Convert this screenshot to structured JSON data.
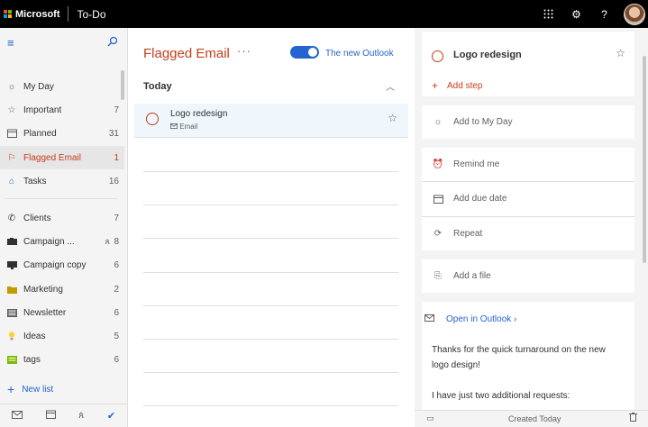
{
  "topbar": {
    "brand": "Microsoft",
    "app_name": "To-Do",
    "icons": [
      "app-launcher-icon",
      "settings-icon",
      "help-icon"
    ]
  },
  "sidebar": {
    "items": [
      {
        "label": "My Day",
        "count": "",
        "icon": "sun-icon"
      },
      {
        "label": "Important",
        "count": "7",
        "icon": "star-icon"
      },
      {
        "label": "Planned",
        "count": "31",
        "icon": "calendar-icon"
      },
      {
        "label": "Flagged Email",
        "count": "1",
        "icon": "flag-icon"
      },
      {
        "label": "Tasks",
        "count": "16",
        "icon": "home-icon"
      },
      {
        "label": "Clients",
        "count": "7",
        "icon": "phone-icon"
      },
      {
        "label": "Campaign ...",
        "count": "8",
        "icon": "camera-icon"
      },
      {
        "label": "Campaign copy",
        "count": "6",
        "icon": "monitor-icon"
      },
      {
        "label": "Marketing",
        "count": "2",
        "icon": "folder-icon"
      },
      {
        "label": "Newsletter",
        "count": "6",
        "icon": "newspaper-icon"
      },
      {
        "label": "Ideas",
        "count": "5",
        "icon": "lightbulb-icon"
      },
      {
        "label": "tags",
        "count": "6",
        "icon": "tag-list-icon"
      }
    ],
    "new_list": "New list"
  },
  "main": {
    "title": "Flagged Email",
    "toggle_label": "The new Outlook",
    "group": "Today",
    "task": {
      "title": "Logo redesign",
      "subtitle": "Email"
    }
  },
  "detail": {
    "title": "Logo redesign",
    "add_step": "Add step",
    "add_to_my_day": "Add to My Day",
    "remind_me": "Remind me",
    "add_due_date": "Add due date",
    "repeat": "Repeat",
    "add_file": "Add a file",
    "open_in_outlook": "Open in Outlook ›",
    "note_line1": "Thanks for the quick turnaround on the new",
    "note_line2": "logo design!",
    "note_line3": "I have just two additional requests:",
    "created": "Created Today"
  },
  "colors": {
    "accent_blue": "#2564cf",
    "flagged_red": "#c43e1c"
  }
}
